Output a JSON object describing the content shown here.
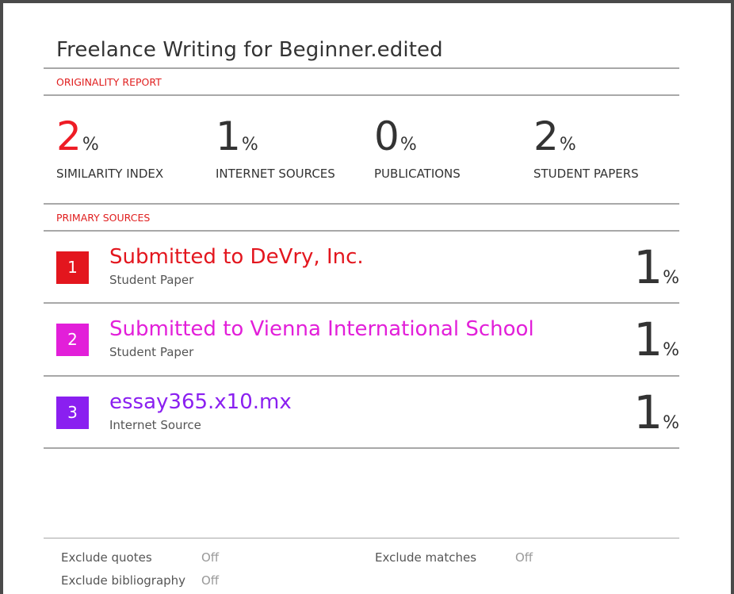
{
  "document": {
    "title": "Freelance Writing for Beginner.edited"
  },
  "originality_report": {
    "heading": "ORIGINALITY REPORT",
    "stats": [
      {
        "value": "2",
        "unit": "%",
        "label": "SIMILARITY INDEX",
        "color": "#ee1c25"
      },
      {
        "value": "1",
        "unit": "%",
        "label": "INTERNET SOURCES"
      },
      {
        "value": "0",
        "unit": "%",
        "label": "PUBLICATIONS"
      },
      {
        "value": "2",
        "unit": "%",
        "label": "STUDENT PAPERS"
      }
    ]
  },
  "primary_sources": {
    "heading": "PRIMARY SOURCES",
    "items": [
      {
        "rank": "1",
        "name": "Submitted to DeVry, Inc.",
        "type": "Student Paper",
        "value": "1",
        "unit": "%",
        "color": "#e3161e"
      },
      {
        "rank": "2",
        "name": "Submitted to Vienna International School",
        "type": "Student Paper",
        "value": "1",
        "unit": "%",
        "color": "#e21fd9"
      },
      {
        "rank": "3",
        "name": "essay365.x10.mx",
        "type": "Internet Source",
        "value": "1",
        "unit": "%",
        "color": "#8a1ff0"
      }
    ]
  },
  "footer": {
    "exclude_quotes_label": "Exclude quotes",
    "exclude_quotes_value": "Off",
    "exclude_bibliography_label": "Exclude bibliography",
    "exclude_bibliography_value": "Off",
    "exclude_matches_label": "Exclude matches",
    "exclude_matches_value": "Off"
  }
}
